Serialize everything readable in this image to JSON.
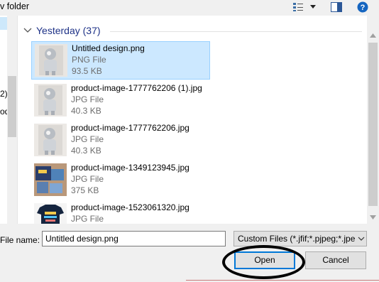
{
  "toolbar": {
    "new_folder_label": "v folder",
    "view_icon": "view-options-icon",
    "dropdown_icon": "chevron-down-icon",
    "preview_icon": "preview-pane-icon",
    "help_icon": "help-icon"
  },
  "nav_pane": {
    "fragments": [
      "2)",
      "od"
    ]
  },
  "group": {
    "label": "Yesterday (37)"
  },
  "files": [
    {
      "name": "Untitled design.png",
      "type": "PNG File",
      "size": "93.5 KB",
      "selected": true,
      "thumb": "robot"
    },
    {
      "name": "product-image-1777762206 (1).jpg",
      "type": "JPG File",
      "size": "40.3 KB",
      "selected": false,
      "thumb": "robot"
    },
    {
      "name": "product-image-1777762206.jpg",
      "type": "JPG File",
      "size": "40.3 KB",
      "selected": false,
      "thumb": "robot"
    },
    {
      "name": "product-image-1349123945.jpg",
      "type": "JPG File",
      "size": "375 KB",
      "selected": false,
      "thumb": "kids-clothes"
    },
    {
      "name": "product-image-1523061320.jpg",
      "type": "JPG File",
      "size": "",
      "selected": false,
      "thumb": "tshirt"
    }
  ],
  "bottom": {
    "file_name_label": "File name:",
    "file_name_value": "Untitled design.png",
    "file_type_value": "Custom Files (*.jfif;*.pjpeg;*.jpe",
    "open_label": "Open",
    "cancel_label": "Cancel"
  },
  "colors": {
    "selection": "#cce8ff",
    "group_header": "#1e3287",
    "accent": "#0078d7"
  }
}
